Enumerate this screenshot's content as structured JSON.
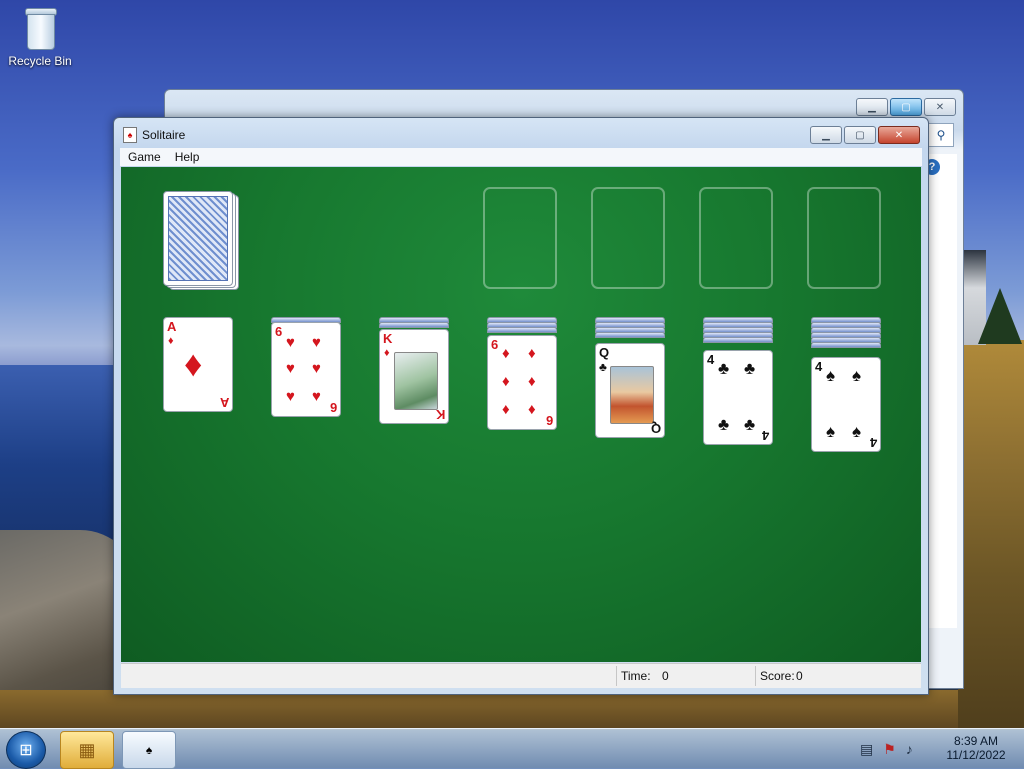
{
  "desktop": {
    "recycle_bin_label": "Recycle Bin"
  },
  "background_window": {
    "caption_buttons": [
      "minimize",
      "maximize",
      "close"
    ]
  },
  "window": {
    "title": "Solitaire",
    "menus": [
      {
        "label": "Game"
      },
      {
        "label": "Help"
      }
    ]
  },
  "status_bar": {
    "time_label": "Time:",
    "time_value": "0",
    "score_label": "Score:",
    "score_value": "0"
  },
  "game": {
    "stock": "face-down deck",
    "foundations": [
      "empty",
      "empty",
      "empty",
      "empty"
    ],
    "tableau": [
      {
        "hidden": 0,
        "top": {
          "rank": "A",
          "suit": "♦",
          "color": "red"
        }
      },
      {
        "hidden": 1,
        "top": {
          "rank": "6",
          "suit": "♥",
          "color": "red"
        }
      },
      {
        "hidden": 2,
        "top": {
          "rank": "K",
          "suit": "♦",
          "color": "red"
        }
      },
      {
        "hidden": 3,
        "top": {
          "rank": "6",
          "suit": "♦",
          "color": "red"
        }
      },
      {
        "hidden": 4,
        "top": {
          "rank": "Q",
          "suit": "♣",
          "color": "black"
        }
      },
      {
        "hidden": 5,
        "top": {
          "rank": "4",
          "suit": "♣",
          "color": "black"
        }
      },
      {
        "hidden": 6,
        "top": {
          "rank": "4",
          "suit": "♠",
          "color": "black"
        }
      }
    ]
  },
  "taskbar": {
    "clock_time": "8:39 AM",
    "clock_date": "11/12/2022"
  },
  "colors": {
    "felt": "#17782f",
    "red_suit": "#d4161e",
    "black_suit": "#111111"
  }
}
